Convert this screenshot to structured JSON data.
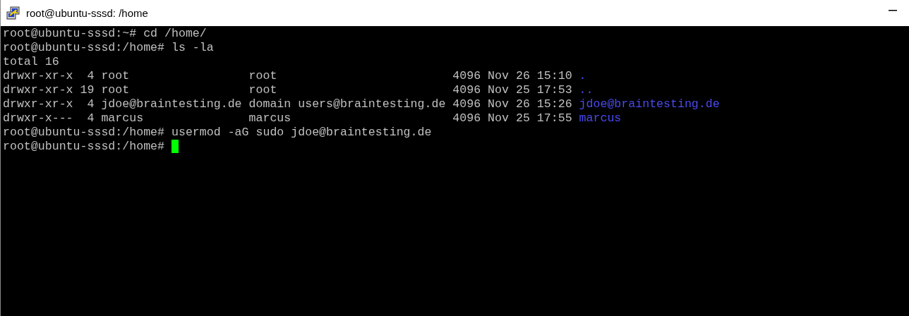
{
  "window": {
    "title": "root@ubuntu-sssd: /home"
  },
  "terminal": {
    "lines": [
      {
        "kind": "output",
        "text": "root@ubuntu-sssd:~# cd /home/"
      },
      {
        "kind": "output",
        "text": "root@ubuntu-sssd:/home# ls -la"
      },
      {
        "kind": "output",
        "text": "total 16"
      },
      {
        "kind": "entry",
        "text": "drwxr-xr-x  4 root                 root                         4096 Nov 26 15:10",
        "name": "."
      },
      {
        "kind": "entry",
        "text": "drwxr-xr-x 19 root                 root                         4096 Nov 25 17:53",
        "name": ".."
      },
      {
        "kind": "entry",
        "text": "drwxr-xr-x  4 jdoe@braintesting.de domain users@braintesting.de 4096 Nov 26 15:26",
        "name": "jdoe@braintesting.de"
      },
      {
        "kind": "entry",
        "text": "drwxr-x---  4 marcus               marcus                       4096 Nov 25 17:55",
        "name": "marcus"
      },
      {
        "kind": "output",
        "text": "root@ubuntu-sssd:/home# usermod -aG sudo jdoe@braintesting.de"
      },
      {
        "kind": "prompt",
        "text": "root@ubuntu-sssd:/home#",
        "cursor": true
      }
    ]
  }
}
